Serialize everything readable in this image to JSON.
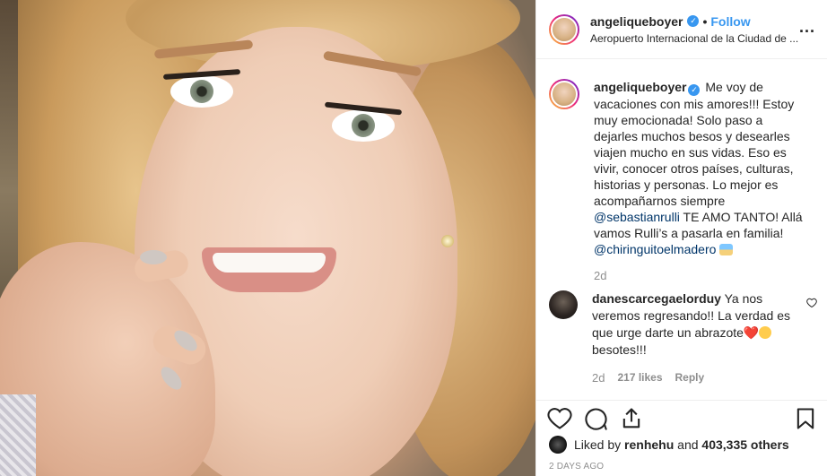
{
  "post": {
    "username": "angeliqueboyer",
    "follow_label": "Follow",
    "separator": "•",
    "location": "Aeropuerto Internacional de la Ciudad de ...",
    "more_label": "...",
    "verified_glyph": "✓"
  },
  "caption": {
    "username": "angeliqueboyer",
    "text_part1": " Me voy de vacaciones con mis amores!!! Estoy muy emocionada! Solo paso a dejarles muchos besos y desearles viajen mucho en sus vidas. Eso es vivir, conocer otros países, culturas, historias y personas. Lo mejor es acompañarnos siempre ",
    "mention1": "@sebastianrulli",
    "text_part2": " TE AMO TANTO! Allá vamos Rulli’s a pasarla en familia! ",
    "mention2": "@chiringuitoelmadero",
    "time": "2d"
  },
  "comment": {
    "username": "danescarcegaelorduy",
    "text": " Ya nos veremos regresando!! La verdad es que urge darte un abrazote",
    "heart": "❤️",
    "text_end": "besotes!!!",
    "time": "2d",
    "likes": "217 likes",
    "reply_label": "Reply"
  },
  "footer": {
    "liked_by_prefix": "Liked by ",
    "liked_by_user": "renhehu",
    "liked_by_mid": " and ",
    "liked_by_count": "403,335 others",
    "date": "2 DAYS AGO"
  },
  "icons": [
    "heart-icon",
    "comment-icon",
    "share-icon",
    "bookmark-icon",
    "more-options-icon",
    "verified-icon"
  ],
  "colors": {
    "link": "#3897f0",
    "mention": "#003569",
    "muted": "#8e8e8e",
    "text": "#262626"
  }
}
